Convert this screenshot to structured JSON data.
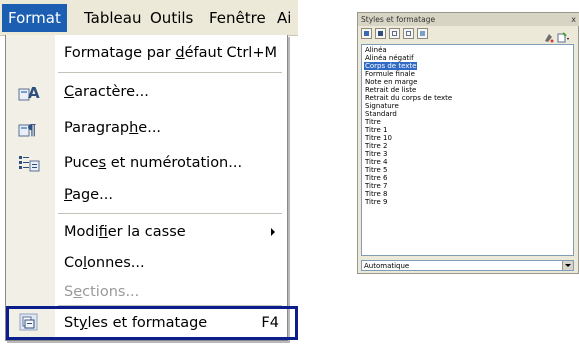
{
  "menubar": {
    "items": [
      {
        "label": "Format",
        "underline": "t"
      },
      {
        "label": "Tableau",
        "underline": "b"
      },
      {
        "label": "Outils",
        "underline": "O"
      },
      {
        "label": "Fenêtre",
        "underline": "n"
      },
      {
        "label": "Ai"
      }
    ],
    "active_color": "#1b5eb2"
  },
  "format_menu": {
    "items": [
      {
        "pre": "Formatage par ",
        "key": "d",
        "post": "éfaut",
        "shortcut": "Ctrl+M",
        "icon": null
      },
      {
        "pre": "",
        "key": "C",
        "post": "aractère...",
        "icon": "character-icon"
      },
      {
        "pre": "Paragrap",
        "key": "h",
        "post": "e...",
        "icon": "paragraph-icon"
      },
      {
        "pre": "Puce",
        "key": "s",
        "post": " et numérotation...",
        "icon": "bullets-numbering-icon"
      },
      {
        "pre": "",
        "key": "P",
        "post": "age...",
        "icon": null
      },
      {
        "pre": "Modi",
        "key": "f",
        "post": "ier la casse",
        "submenu": true
      },
      {
        "pre": "Co",
        "key": "l",
        "post": "onnes..."
      },
      {
        "pre": "S",
        "key": "e",
        "post": "ctions...",
        "disabled": true
      },
      {
        "pre": "St",
        "key": "y",
        "post": "les et formatage",
        "shortcut": "F4",
        "icon": "styles-formatting-icon",
        "highlighted": true
      }
    ]
  },
  "styles_panel": {
    "title": "Styles et formatage",
    "close_label": "x",
    "styles": [
      "Alinéa",
      "Alinéa négatif",
      "Corps de texte",
      "Formule finale",
      "Note en marge",
      "Retrait de liste",
      "Retrait du corps de texte",
      "Signature",
      "Standard",
      "Titre",
      "Titre 1",
      "Titre 10",
      "Titre 2",
      "Titre 3",
      "Titre 4",
      "Titre 5",
      "Titre 6",
      "Titre 7",
      "Titre 8",
      "Titre 9"
    ],
    "selected_style": "Corps de texte",
    "filter_value": "Automatique"
  }
}
